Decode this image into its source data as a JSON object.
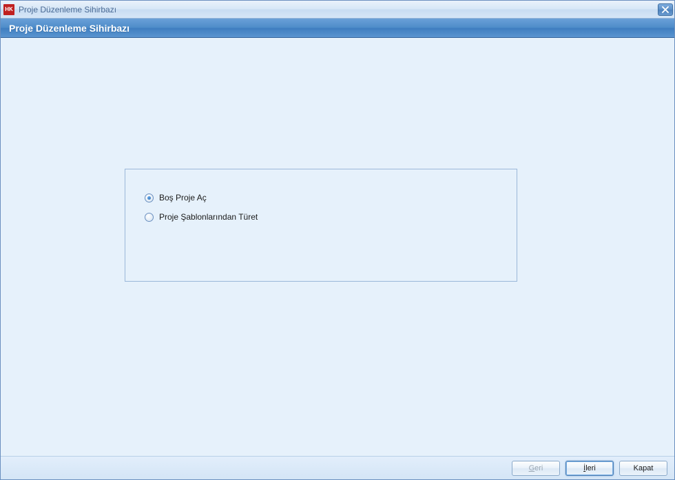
{
  "window": {
    "title": "Proje Düzenleme Sihirbazı",
    "icon_text": "HK"
  },
  "header": {
    "title": "Proje Düzenleme Sihirbazı"
  },
  "options": {
    "empty_project": "Boş Proje Aç",
    "from_template": "Proje Şablonlarından Türet",
    "selected": "empty_project"
  },
  "footer": {
    "back_label": "Geri",
    "back_underlined": "G",
    "next_label": "İleri",
    "next_underlined": "İ",
    "close_label": "Kapat"
  }
}
